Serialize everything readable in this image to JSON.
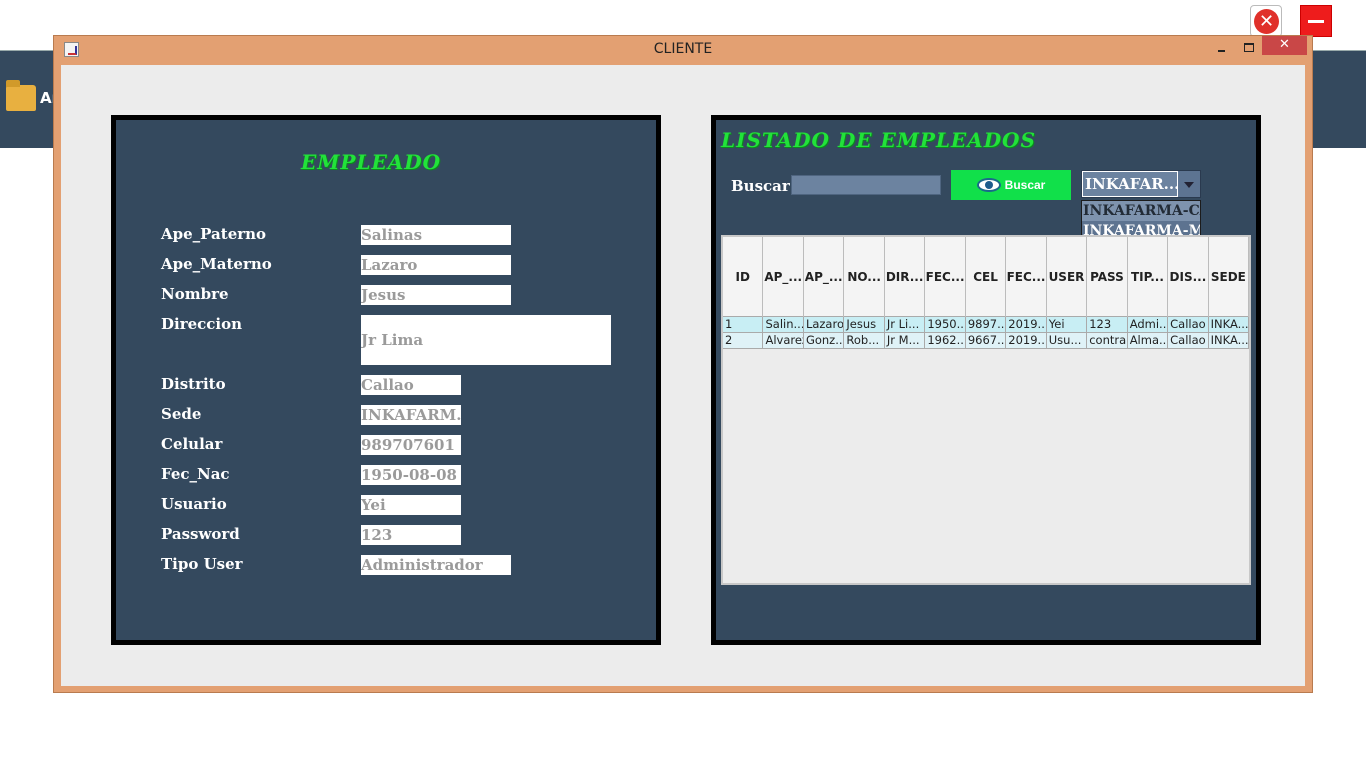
{
  "background": {
    "app_label": "Ar"
  },
  "window": {
    "title": "CLIENTE",
    "close_label": "✕"
  },
  "form": {
    "heading": "EMPLEADO",
    "fields": [
      {
        "label": "Ape_Paterno",
        "value": "Salinas"
      },
      {
        "label": "Ape_Materno",
        "value": "Lazaro"
      },
      {
        "label": "Nombre",
        "value": "Jesus"
      },
      {
        "label": "Direccion",
        "value": "Jr Lima"
      },
      {
        "label": "Distrito",
        "value": "Callao"
      },
      {
        "label": "Sede",
        "value": "INKAFARM..."
      },
      {
        "label": "Celular",
        "value": "989707601"
      },
      {
        "label": "Fec_Nac",
        "value": "1950-08-08"
      },
      {
        "label": "Usuario",
        "value": "Yei"
      },
      {
        "label": "Password",
        "value": "123"
      },
      {
        "label": "Tipo User",
        "value": "Administrador"
      }
    ]
  },
  "listado": {
    "heading": "LISTADO DE EMPLEADOS",
    "search_label": "Buscar:",
    "search_value": "",
    "search_button": "Buscar",
    "combo_selected": "INKAFAR...",
    "combo_options": [
      "INKAFARMA-CA",
      "INKAFARMA-MO"
    ],
    "columns": [
      "ID",
      "AP_...",
      "AP_...",
      "NO...",
      "DIR...",
      "FEC...",
      "CEL",
      "FEC...",
      "USER",
      "PASS",
      "TIP...",
      "DIS...",
      "SEDE"
    ],
    "rows": [
      [
        "1",
        "Salin...",
        "Lazaro",
        "Jesus",
        "Jr Li...",
        "1950...",
        "9897...",
        "2019...",
        "Yei",
        "123",
        "Admi...",
        "Callao",
        "INKA..."
      ],
      [
        "2",
        "Alvarez",
        "Gonz...",
        "Rob...",
        "Jr M...",
        "1962...",
        "9667...",
        "2019...",
        "Usu...",
        "contra",
        "Alma...",
        "Callao",
        "INKA..."
      ]
    ]
  }
}
